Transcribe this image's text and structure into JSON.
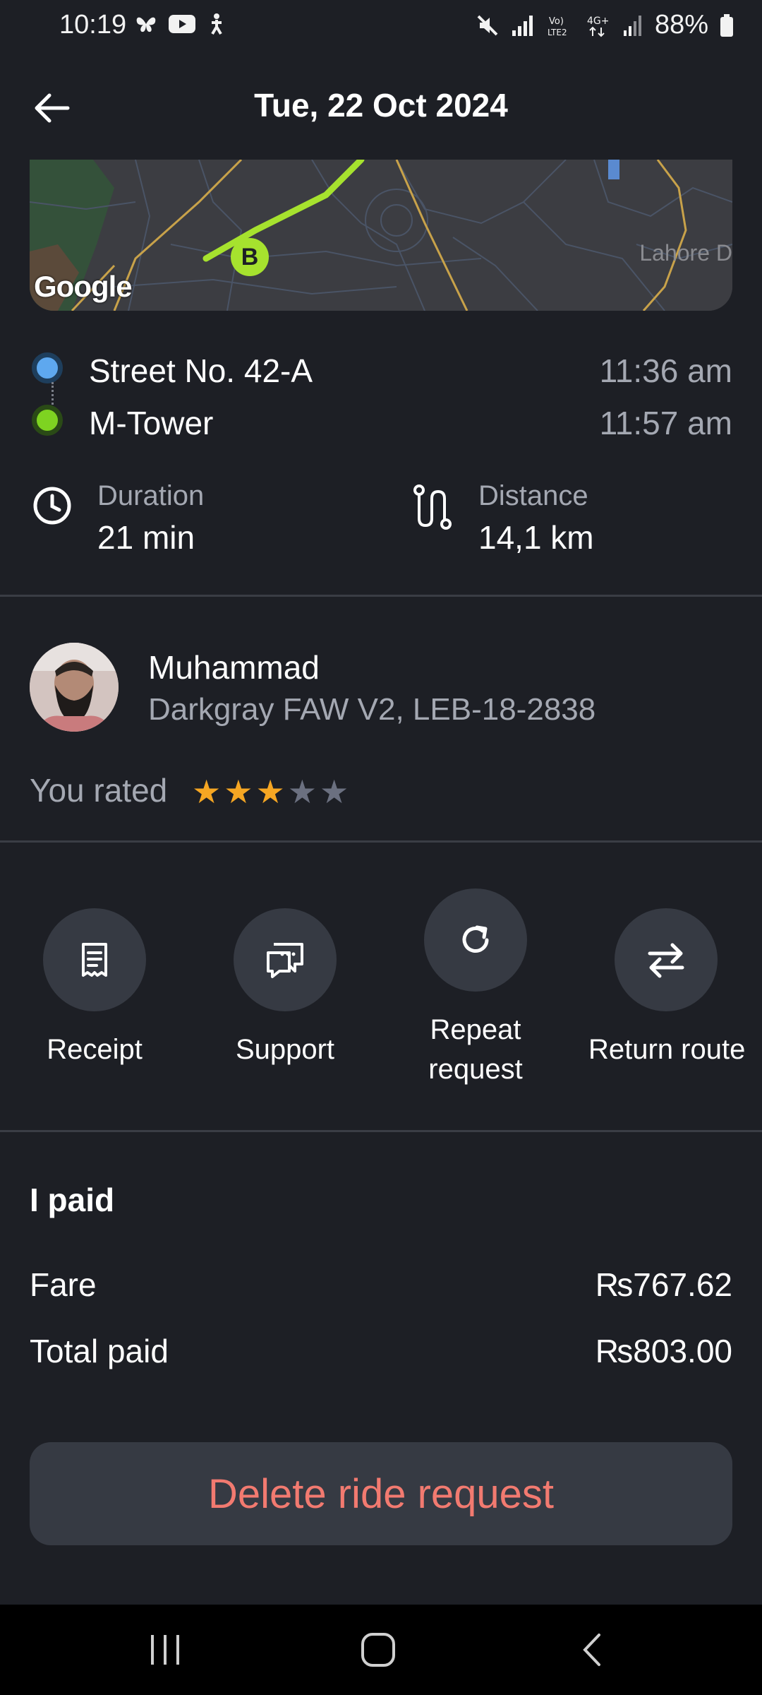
{
  "status_bar": {
    "time": "10:19",
    "battery": "88%"
  },
  "header": {
    "title": "Tue, 22 Oct 2024"
  },
  "map": {
    "place_label": "Lahore D",
    "marker_label": "B",
    "attribution": "Google"
  },
  "route": {
    "pickup": {
      "name": "Street No. 42-A",
      "time": "11:36 am"
    },
    "dropoff": {
      "name": "M-Tower",
      "time": "11:57 am"
    }
  },
  "stats": {
    "duration_label": "Duration",
    "duration_value": "21 min",
    "distance_label": "Distance",
    "distance_value": "14,1 km"
  },
  "driver": {
    "name": "Muhammad",
    "car": "Darkgray FAW V2, LEB-18-2838",
    "rated_label": "You rated",
    "rating": 3,
    "rating_max": 5
  },
  "actions": [
    {
      "label": "Receipt",
      "icon": "receipt-icon"
    },
    {
      "label": "Support",
      "icon": "chat-support-icon"
    },
    {
      "label": "Repeat request",
      "icon": "repeat-icon"
    },
    {
      "label": "Return route",
      "icon": "swap-arrows-icon"
    }
  ],
  "payment": {
    "title": "I paid",
    "rows": [
      {
        "label": "Fare",
        "value": "₨767.62"
      },
      {
        "label": "Total paid",
        "value": "₨803.00"
      }
    ]
  },
  "delete_label": "Delete ride request",
  "colors": {
    "background": "#1d1f25",
    "card": "#363a43",
    "muted_text": "#a4a8b2",
    "delete_text": "#f27a70",
    "route_green": "#a6e22e",
    "star_active": "#f5a623",
    "star_inactive": "#6b7080"
  }
}
